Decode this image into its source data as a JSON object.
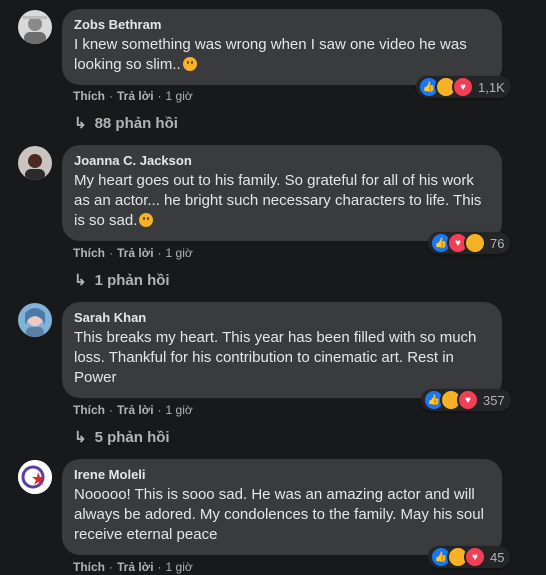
{
  "comments": [
    {
      "author": "Zobs Bethram",
      "text": "I knew something was wrong when I saw one video he was looking so slim..",
      "reaction_count": "1,1K",
      "like": "Thích",
      "reply": "Trả lời",
      "time": "1 giờ",
      "replies": "88 phản hồi"
    },
    {
      "author": "Joanna C. Jackson",
      "text": "My heart goes out to his family. So grateful for all of his work as an actor... he bright such necessary characters to life. This is so sad.",
      "reaction_count": "76",
      "like": "Thích",
      "reply": "Trả lời",
      "time": "1 giờ",
      "replies": "1 phản hồi"
    },
    {
      "author": "Sarah Khan",
      "text": "This breaks my heart. This year has been filled with so much loss. Thankful for his contribution to cinematic art. Rest in Power",
      "reaction_count": "357",
      "like": "Thích",
      "reply": "Trả lời",
      "time": "1 giờ",
      "replies": "5 phản hồi"
    },
    {
      "author": "Irene Moleli",
      "text": "Nooooo! This is sooo sad. He was an amazing actor and will always be adored. My condolences to the family. May his soul receive eternal peace",
      "reaction_count": "45",
      "like": "Thích",
      "reply": "Trả lời",
      "time": "1 giờ"
    }
  ],
  "icons": {
    "like": "thumbs-up-icon",
    "sad": "sad-face-icon",
    "love": "heart-icon",
    "reply_arrow": "reply-arrow-icon"
  },
  "colors": {
    "background": "#18191a",
    "bubble": "#3a3b3c",
    "like_blue": "#1877f2",
    "sad_yellow": "#f7b125",
    "love_red": "#f33e58"
  }
}
